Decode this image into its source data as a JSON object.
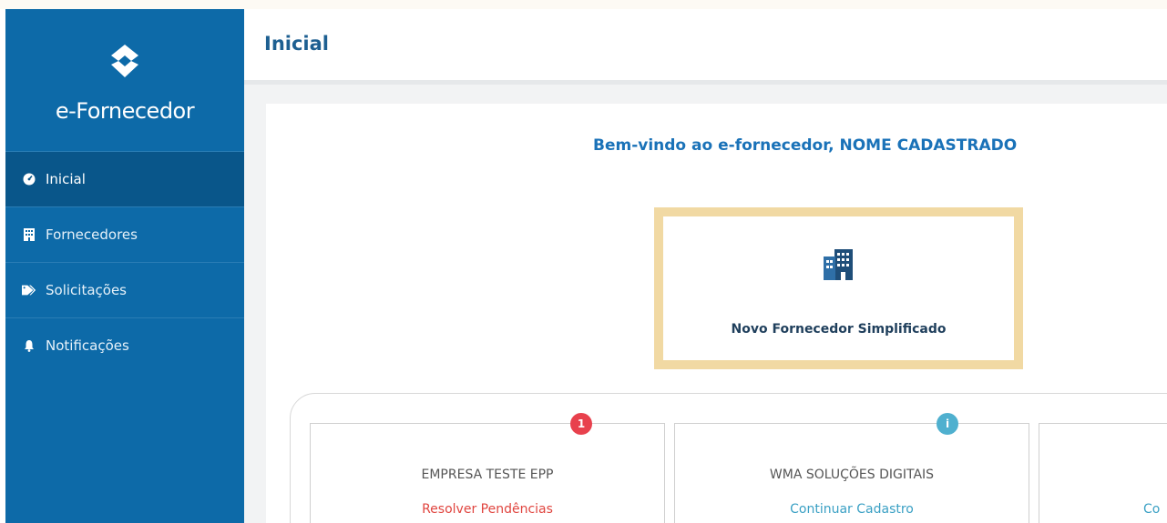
{
  "app": {
    "brand_name": "e-Fornecedor"
  },
  "sidebar": {
    "items": [
      {
        "label": "Inicial",
        "icon": "dashboard-icon",
        "active": true
      },
      {
        "label": "Fornecedores",
        "icon": "building-icon",
        "active": false
      },
      {
        "label": "Solicitações",
        "icon": "tags-icon",
        "active": false
      },
      {
        "label": "Notificações",
        "icon": "bell-icon",
        "active": false
      }
    ]
  },
  "header": {
    "title": "Inicial"
  },
  "main": {
    "welcome": "Bem-vindo ao e-fornecedor, NOME CADASTRADO",
    "action_card": {
      "label": "Novo Fornecedor Simplificado",
      "icon": "building-icon"
    },
    "companies": [
      {
        "name": "EMPRESA TESTE EPP",
        "action": "Resolver Pendências",
        "action_color": "#e0453f",
        "badge": "1",
        "badge_color": "#e8414d"
      },
      {
        "name": "WMA SOLUÇÕES DIGITAIS",
        "action": "Continuar Cadastro",
        "action_color": "#3aa0c4",
        "badge": "i",
        "badge_color": "#4fb0cf"
      },
      {
        "name": "",
        "action": "Co",
        "action_color": "#3aa0c4"
      }
    ]
  },
  "colors": {
    "sidebar_bg": "#0d6aa8",
    "sidebar_active": "#09568a",
    "title": "#1d5f91",
    "accent_border": "#f1d9a3"
  }
}
